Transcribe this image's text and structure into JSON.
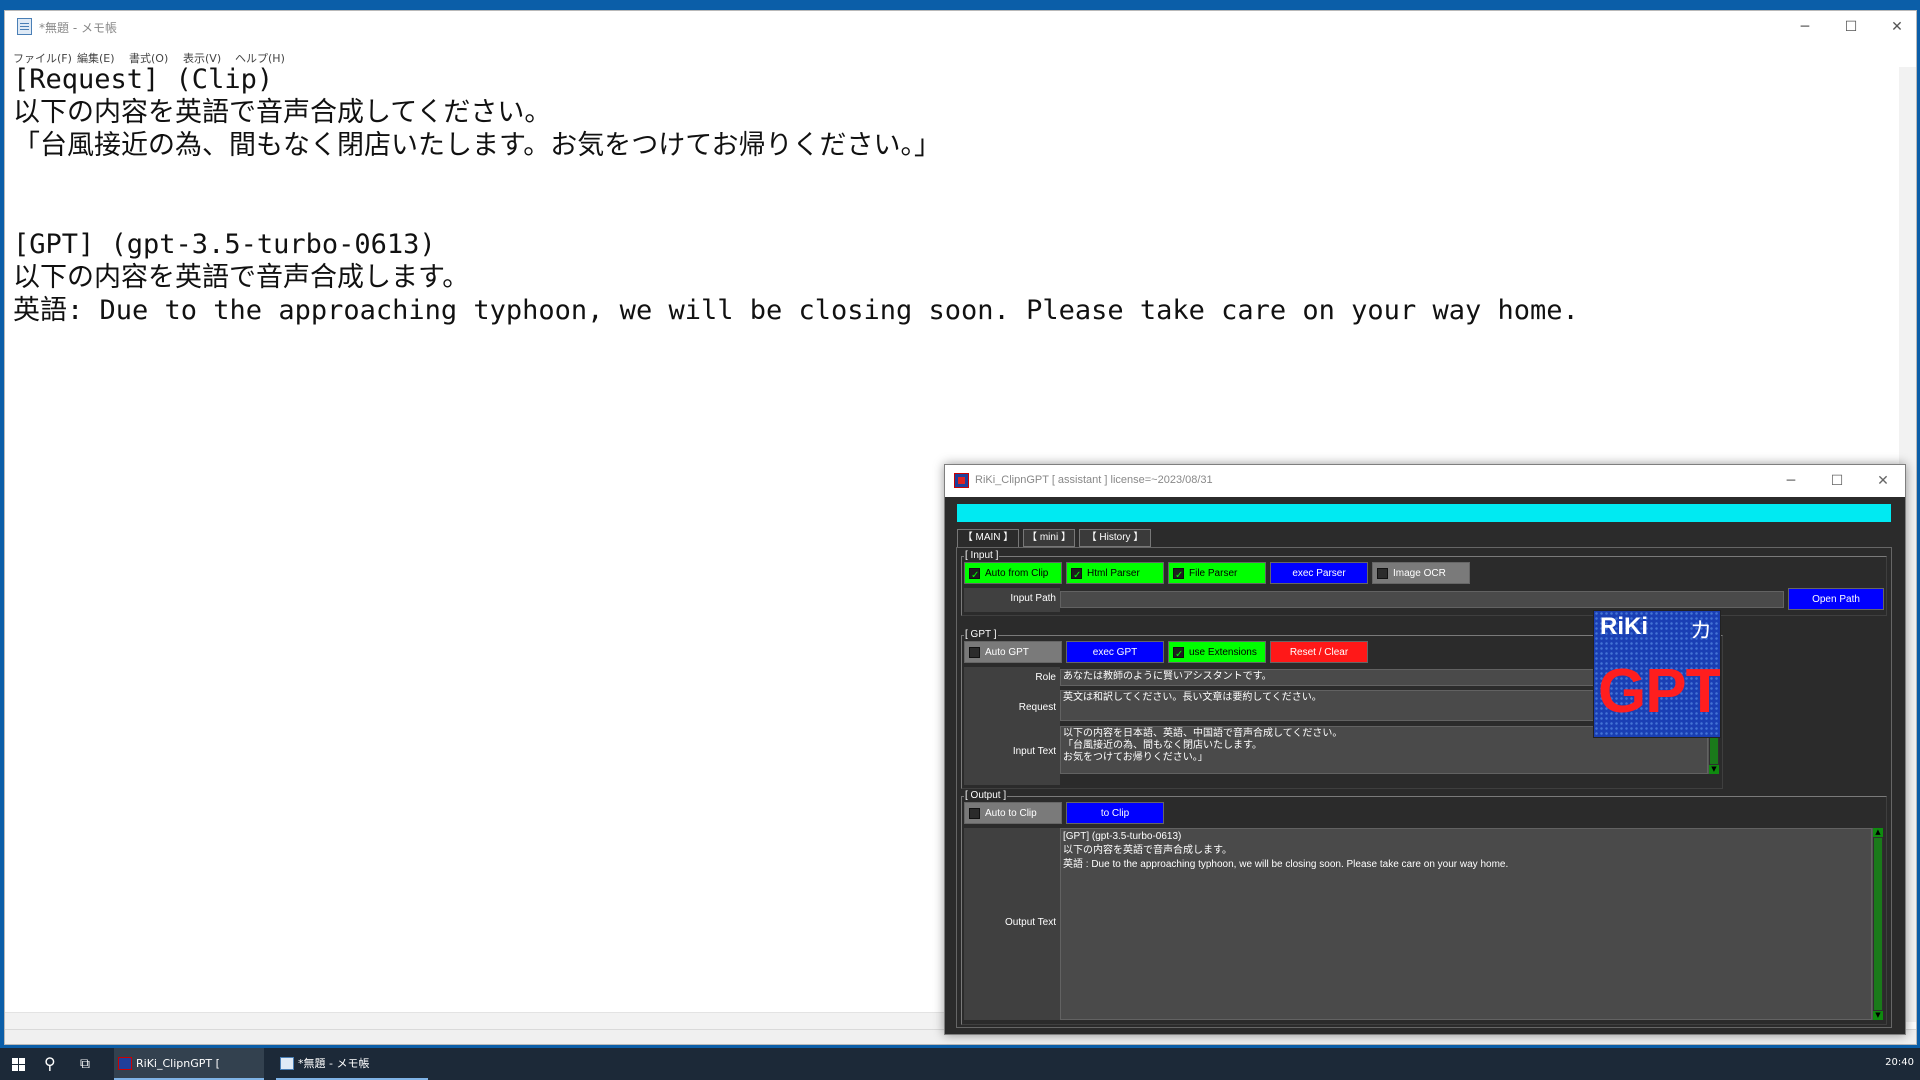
{
  "notepad": {
    "title": "*無題 - メモ帳",
    "menu": [
      "ファイル(F)",
      "編集(E)",
      "書式(O)",
      "表示(V)",
      "ヘルプ(H)"
    ],
    "lines": [
      "[Request] (Clip)",
      "以下の内容を英語で音声合成してください。",
      "「台風接近の為、間もなく閉店いたします。お気をつけてお帰りください。」",
      "",
      "",
      "[GPT] (gpt-3.5-turbo-0613)",
      "以下の内容を英語で音声合成します。",
      "英語: Due to the approaching typhoon, we will be closing soon. Please take care on your way home."
    ]
  },
  "clipngpt": {
    "title": "RiKi_ClipnGPT [ assistant ] license=~2023/08/31",
    "tabs": [
      "【 MAIN 】",
      "【 mini 】",
      "【 History 】"
    ],
    "input_group": {
      "label": "[ Input ]",
      "auto_from_clip": "Auto from Clip",
      "html_parser": "Html Parser",
      "file_parser": "File Parser",
      "exec_parser": "exec Parser",
      "image_ocr": "Image OCR",
      "input_path_label": "Input Path",
      "input_path_value": "",
      "open_path": "Open Path"
    },
    "gpt_group": {
      "label": "[ GPT ]",
      "auto_gpt": "Auto GPT",
      "exec_gpt": "exec GPT",
      "use_extensions": "use Extensions",
      "reset_clear": "Reset / Clear",
      "role_label": "Role",
      "role_value": "あなたは教師のように賢いアシスタントです。",
      "request_label": "Request",
      "request_value": "英文は和訳してください。長い文章は要約してください。",
      "input_text_label": "Input Text",
      "input_text_value": "以下の内容を日本語、英語、中国語で音声合成してください。\n「台風接近の為、間もなく閉店いたします。\nお気をつけてお帰りください。」"
    },
    "output_group": {
      "label": "[ Output ]",
      "auto_to_clip": "Auto to Clip",
      "to_clip": "to Clip",
      "output_text_label": "Output Text",
      "output_text_value": "[GPT] (gpt-3.5-turbo-0613)\n以下の内容を英語で音声合成します。\n英語 : Due to the approaching typhoon, we will be closing soon. Please take care on your way home."
    },
    "logo": {
      "line1": "RiKi",
      "mark": "カ",
      "line2": "GPT"
    },
    "colors": {
      "accent": "#00eaf2",
      "blue": "#0000ff",
      "green": "#00ff00",
      "red": "#ff1818"
    }
  },
  "taskbar": {
    "items": [
      "RiKi_ClipnGPT [ assist...",
      "*無題 - メモ帳"
    ],
    "clock": "20:40"
  }
}
